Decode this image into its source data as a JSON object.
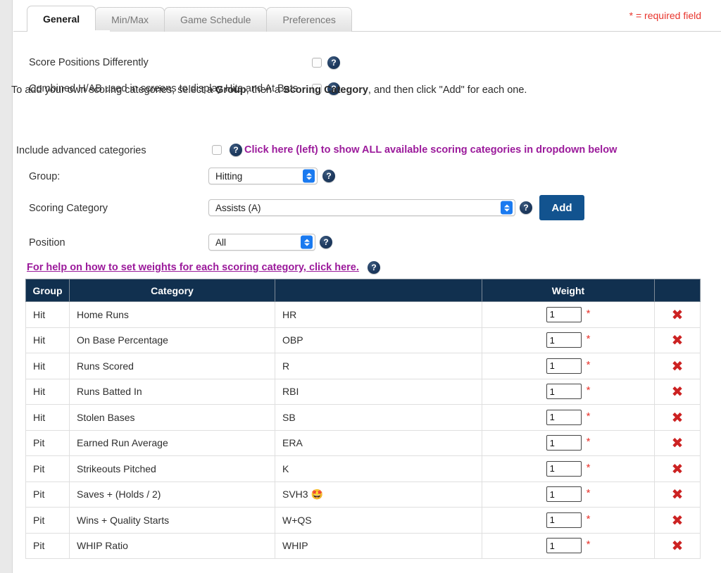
{
  "header": {
    "required_note": "* = required field",
    "tabs": [
      {
        "label": "General",
        "active": true
      },
      {
        "label": "Min/Max",
        "active": false
      },
      {
        "label": "Game Schedule",
        "active": false
      },
      {
        "label": "Preferences",
        "active": false
      }
    ]
  },
  "options": {
    "score_positions_label": "Score Positions Differently",
    "score_positions_checked": false,
    "combined_hab_label": "Combined H/AB used in screens to display Hits and At Bats",
    "combined_hab_checked": false,
    "help_icon": "question-mark-icon"
  },
  "intro": {
    "part1": "To add your own scoring categories, select a ",
    "bold1": "Group",
    "part2": ", then a ",
    "bold2": "Scoring Category",
    "part3": ", and then click \"Add\" for each one."
  },
  "advanced": {
    "label": "Include advanced categories",
    "checked": false,
    "note": "Click here (left) to show ALL available scoring categories in dropdown below",
    "note_color": "#9b1a9b"
  },
  "form": {
    "group_label": "Group:",
    "group_value": "Hitting",
    "category_label": "Scoring Category",
    "category_value": "Assists (A)",
    "position_label": "Position",
    "position_value": "All",
    "add_label": "Add",
    "add_color": "#12538f"
  },
  "help_link": {
    "text": "For help on how to set weights for each scoring category, click here.",
    "color": "#9b1a9b"
  },
  "table": {
    "header_bg": "#11304f",
    "columns": [
      "Group",
      "Category",
      "",
      "Weight",
      ""
    ],
    "rows": [
      {
        "group": "Hit",
        "category": "Home Runs",
        "abbr": "HR",
        "emoji": "",
        "weight": "1",
        "required": "*",
        "delete": "delete-icon"
      },
      {
        "group": "Hit",
        "category": "On Base Percentage",
        "abbr": "OBP",
        "emoji": "",
        "weight": "1",
        "required": "*",
        "delete": "delete-icon"
      },
      {
        "group": "Hit",
        "category": "Runs Scored",
        "abbr": "R",
        "emoji": "",
        "weight": "1",
        "required": "*",
        "delete": "delete-icon"
      },
      {
        "group": "Hit",
        "category": "Runs Batted In",
        "abbr": "RBI",
        "emoji": "",
        "weight": "1",
        "required": "*",
        "delete": "delete-icon"
      },
      {
        "group": "Hit",
        "category": "Stolen Bases",
        "abbr": "SB",
        "emoji": "",
        "weight": "1",
        "required": "*",
        "delete": "delete-icon"
      },
      {
        "group": "Pit",
        "category": "Earned Run Average",
        "abbr": "ERA",
        "emoji": "",
        "weight": "1",
        "required": "*",
        "delete": "delete-icon"
      },
      {
        "group": "Pit",
        "category": "Strikeouts Pitched",
        "abbr": "K",
        "emoji": "",
        "weight": "1",
        "required": "*",
        "delete": "delete-icon"
      },
      {
        "group": "Pit",
        "category": "Saves + (Holds / 2)",
        "abbr": "SVH3",
        "emoji": "🤩",
        "weight": "1",
        "required": "*",
        "delete": "delete-icon"
      },
      {
        "group": "Pit",
        "category": "Wins + Quality Starts",
        "abbr": "W+QS",
        "emoji": "",
        "weight": "1",
        "required": "*",
        "delete": "delete-icon"
      },
      {
        "group": "Pit",
        "category": "WHIP Ratio",
        "abbr": "WHIP",
        "emoji": "",
        "weight": "1",
        "required": "*",
        "delete": "delete-icon"
      }
    ]
  },
  "icons": {
    "delete_glyph": "✖",
    "question_glyph": "?"
  }
}
